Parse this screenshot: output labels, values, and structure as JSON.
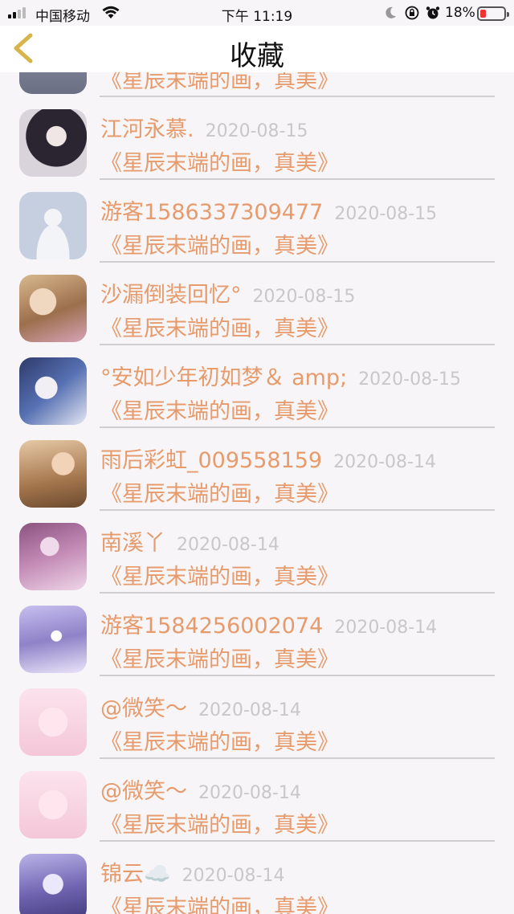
{
  "status": {
    "carrier": "中国移动",
    "time": "下午 11:19",
    "battery": "18%"
  },
  "header": {
    "title": "收藏"
  },
  "partial_row": {
    "comment": "《星辰末端的画，真美》"
  },
  "items": [
    {
      "name": "江河永慕.",
      "date": "2020-08-15",
      "comment": "《星辰末端的画，真美》",
      "avatar_color": "#d8d4da"
    },
    {
      "name": "游客1586337309477",
      "date": "2020-08-15",
      "comment": "《星辰末端的画，真美》",
      "avatar_color": "#c9d3e3"
    },
    {
      "name": "沙漏倒装回忆°",
      "date": "2020-08-15",
      "comment": "《星辰末端的画，真美》",
      "avatar_color": "#c9a88a"
    },
    {
      "name": "°安如少年初如梦＆ amp;",
      "date": "2020-08-15",
      "comment": "《星辰末端的画，真美》",
      "avatar_color": "#5b6a9b"
    },
    {
      "name": "雨后彩虹_009558159",
      "date": "2020-08-14",
      "comment": "《星辰末端的画，真美》",
      "avatar_color": "#c79a6e"
    },
    {
      "name": "南溪丫",
      "date": "2020-08-14",
      "comment": "《星辰末端的画，真美》",
      "avatar_color": "#b77aa6"
    },
    {
      "name": "游客1584256002074",
      "date": "2020-08-14",
      "comment": "《星辰末端的画，真美》",
      "avatar_color": "#a79ad0"
    },
    {
      "name": "@微笑～",
      "date": "2020-08-14",
      "comment": "《星辰末端的画，真美》",
      "avatar_color": "#f4d5e0"
    },
    {
      "name": "@微笑～",
      "date": "2020-08-14",
      "comment": "《星辰末端的画，真美》",
      "avatar_color": "#f4d5e0"
    },
    {
      "name": "锦云☁️",
      "date": "2020-08-14",
      "comment": "《星辰末端的画，真美》",
      "avatar_color": "#8a7fc0"
    }
  ]
}
